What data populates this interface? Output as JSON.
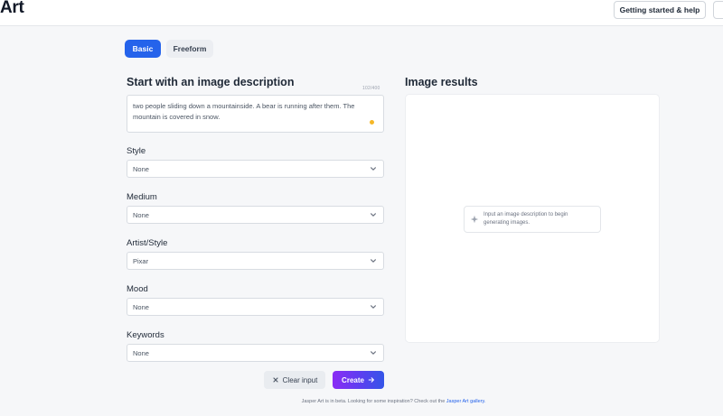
{
  "header": {
    "app_title": "Art",
    "help_button_label": "Getting started & help"
  },
  "tabs": [
    {
      "label": "Basic",
      "active": true
    },
    {
      "label": "Freeform",
      "active": false
    }
  ],
  "form": {
    "heading": "Start with an image description",
    "char_counter": "102/400",
    "description": "two people sliding down a mountainside. A bear is running after them. The mountain is covered in snow.",
    "fields": [
      {
        "label": "Style",
        "value": "None"
      },
      {
        "label": "Medium",
        "value": "None"
      },
      {
        "label": "Artist/Style",
        "value": "Pixar"
      },
      {
        "label": "Mood",
        "value": "None"
      },
      {
        "label": "Keywords",
        "value": "None"
      }
    ],
    "clear_label": "Clear input",
    "create_label": "Create"
  },
  "results": {
    "heading": "Image results",
    "hint_text": "Input an image description to begin generating images."
  },
  "footer": {
    "text": "Jasper Art is in beta. Looking for some inspiration? Check out the",
    "link_text": "Jasper Art gallery."
  },
  "colors": {
    "accent": "#2563eb",
    "create_gradient_start": "#8b2cf5",
    "create_gradient_end": "#3455e8",
    "indicator": "#f5b727"
  },
  "icons": [
    "chevron-down-icon",
    "close-icon",
    "arrow-right-icon",
    "sparkle-icon"
  ]
}
